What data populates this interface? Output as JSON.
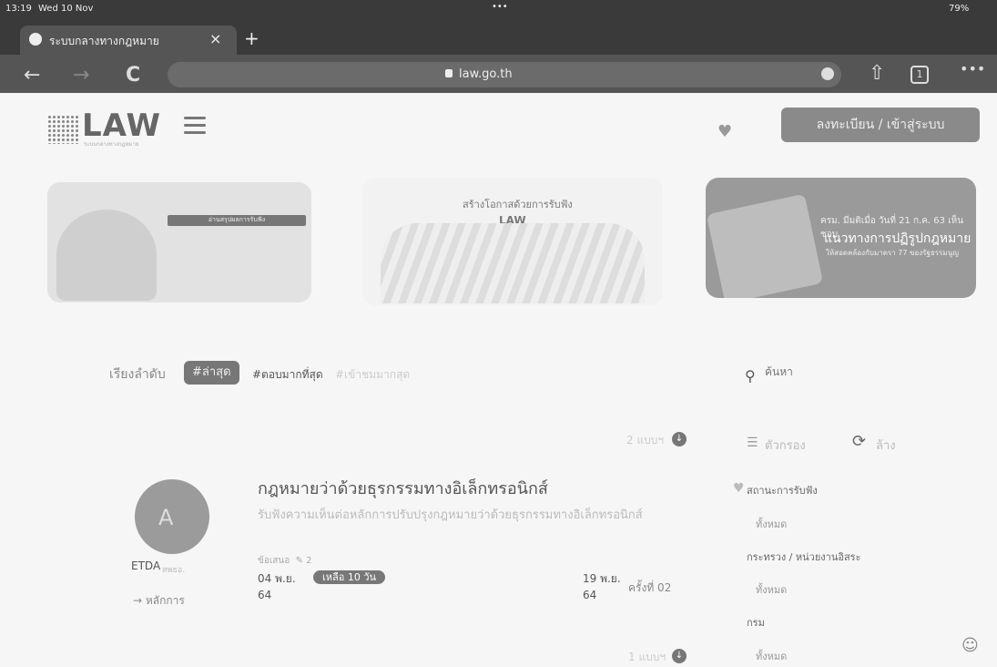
{
  "status": {
    "time": "13:19",
    "date": "Wed 10 Nov",
    "dots": "•••",
    "battery": "79%"
  },
  "tab": {
    "title": "ระบบกลางทางกฎหมาย",
    "close": "×",
    "new": "+"
  },
  "url": "law.go.th",
  "toolbar": {
    "back": "←",
    "forward": "→",
    "reload": "C",
    "share": "⇧",
    "tabs_count": "1",
    "menu": "•••"
  },
  "header": {
    "logo": "LAW",
    "logo_sub": "ระบบกลางทางกฎหมาย",
    "register_button": "ลงทะเบียน / เข้าสู่ระบบ"
  },
  "banners": {
    "b1_label": "อ่านสรุปผลการรับฟัง",
    "b2_title": "สร้างโอกาสด้วยการรับฟัง",
    "b2_logo": "LAW",
    "b3_top": "ครม. มีมติเมื่อ วันที่ 21 ก.ค. 63 เห็นชอบ",
    "b3_main": "แนวทางการปฏิรูปกฎหมาย",
    "b3_sub": "ให้สอดคล้องกับมาตรา 77 ของรัฐธรรมนูญ"
  },
  "sort": {
    "label": "เรียงลำดับ",
    "latest": "#ล่าสุด",
    "most_answered": "#ตอบมากที่สุด",
    "most_viewed": "#เข้าชมมากสุด"
  },
  "search": {
    "placeholder": "ค้นหา"
  },
  "filters": {
    "title": "ตัวกรอง",
    "clear": "ล้าง",
    "status_label": "สถานะการรับฟัง",
    "status_value": "ทั้งหมด",
    "ministry_label": "กระทรวง / หน่วยงานอิสระ",
    "ministry_value": "ทั้งหมด",
    "dept_label": "กรม",
    "dept_value": "ทั้งหมด"
  },
  "more_top": "2 แบบฯ",
  "more_bottom": "1 แบบฯ",
  "post": {
    "org": "ETDA",
    "org_sub": "สพธอ.",
    "principle": "หลักการ",
    "title": "กฎหมายว่าด้วยธุรกรรมทางอิเล็กทรอนิกส์",
    "desc": "รับฟังความเห็นต่อหลักการปรับปรุงกฎหมายว่าด้วยธุรกรรมทางอิเล็กทรอนิกส์",
    "stat_label": "ข้อเสนอ",
    "stat_count": "2",
    "start_date": "04 พ.ย.",
    "start_year": "64",
    "badge": "เหลือ 10 วัน",
    "end_date": "19 พ.ย.",
    "end_year": "64",
    "round": "ครั้งที่ 02"
  }
}
